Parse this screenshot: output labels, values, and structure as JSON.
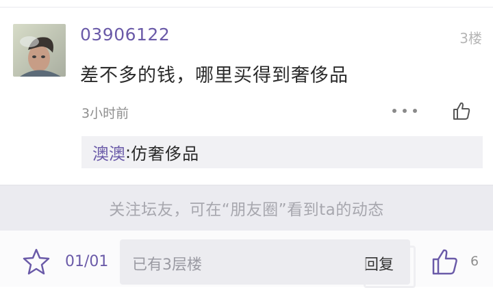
{
  "post": {
    "username": "03906122",
    "floor": "3楼",
    "content": "差不多的钱，哪里买得到奢侈品",
    "time": "3小时前",
    "reply": {
      "user": "澳澳",
      "colon": ":",
      "text": "仿奢侈品"
    }
  },
  "follow_bar": {
    "text": "关注坛友，可在“朋友圈”看到ta的动态"
  },
  "bottom_bar": {
    "page": "01/01",
    "input_placeholder": "已有3层楼",
    "send_label": "回复",
    "like_count": "6"
  },
  "colors": {
    "accent": "#6a5aa8",
    "text": "#2a2a2a",
    "muted": "#8e8e8e",
    "panel": "#ebebf0"
  },
  "icons": [
    "more-icon",
    "thumbs-up-icon",
    "star-icon"
  ]
}
